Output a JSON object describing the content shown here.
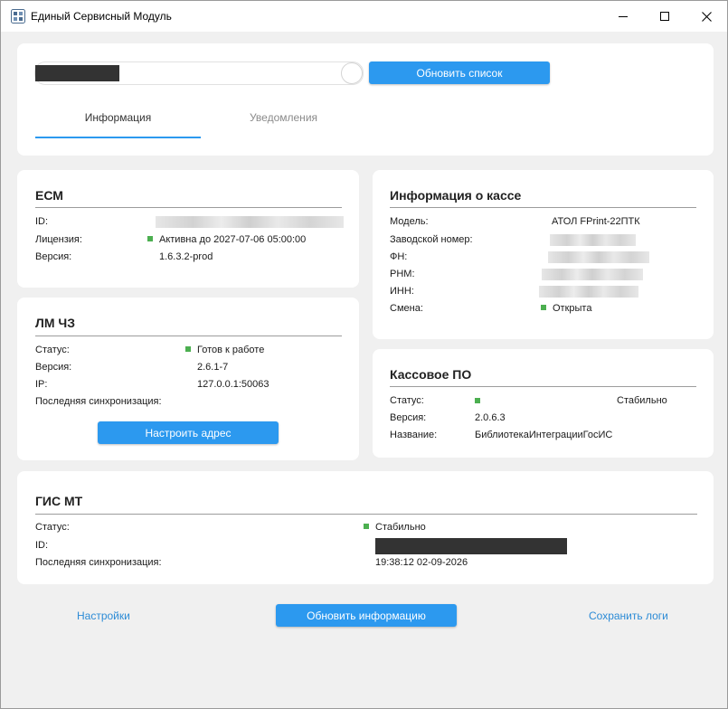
{
  "window": {
    "title": "Единый Сервисный Модуль"
  },
  "top": {
    "refresh_list_label": "Обновить список",
    "tabs": [
      {
        "label": "Информация",
        "active": true
      },
      {
        "label": "Уведомления",
        "active": false
      }
    ]
  },
  "ecm": {
    "title": "ЕСМ",
    "id_label": "ID:",
    "license_label": "Лицензия:",
    "license_value": "Активна до 2027-07-06 05:00:00",
    "version_label": "Версия:",
    "version_value": "1.6.3.2-prod"
  },
  "lm": {
    "title": "ЛМ ЧЗ",
    "status_label": "Статус:",
    "status_value": "Готов к работе",
    "version_label": "Версия:",
    "version_value": "2.6.1-7",
    "ip_label": "IP:",
    "ip_value": "127.0.0.1:50063",
    "sync_label": "Последняя синхронизация:",
    "configure_label": "Настроить адрес"
  },
  "kassa": {
    "title": "Информация о кассе",
    "model_label": "Модель:",
    "model_value": "АТОЛ FPrint-22ПТК",
    "serial_label": "Заводской номер:",
    "fn_label": "ФН:",
    "rnm_label": "РНМ:",
    "inn_label": "ИНН:",
    "shift_label": "Смена:",
    "shift_value": "Открыта"
  },
  "software": {
    "title": "Кассовое ПО",
    "status_label": "Статус:",
    "status_value": "Стабильно",
    "version_label": "Версия:",
    "version_value": "2.0.6.3",
    "name_label": "Название:",
    "name_value": "БиблиотекаИнтеграцииГосИС"
  },
  "gis": {
    "title": "ГИС МТ",
    "status_label": "Статус:",
    "status_value": "Стабильно",
    "id_label": "ID:",
    "sync_label": "Последняя синхронизация:",
    "sync_value": "19:38:12 02-09-2026"
  },
  "footer": {
    "settings_label": "Настройки",
    "refresh_info_label": "Обновить информацию",
    "save_logs_label": "Сохранить логи"
  },
  "colors": {
    "accent": "#2c99ef",
    "link": "#2c8bd6",
    "status_ok": "#4caf50",
    "background": "#f0f0f0"
  }
}
